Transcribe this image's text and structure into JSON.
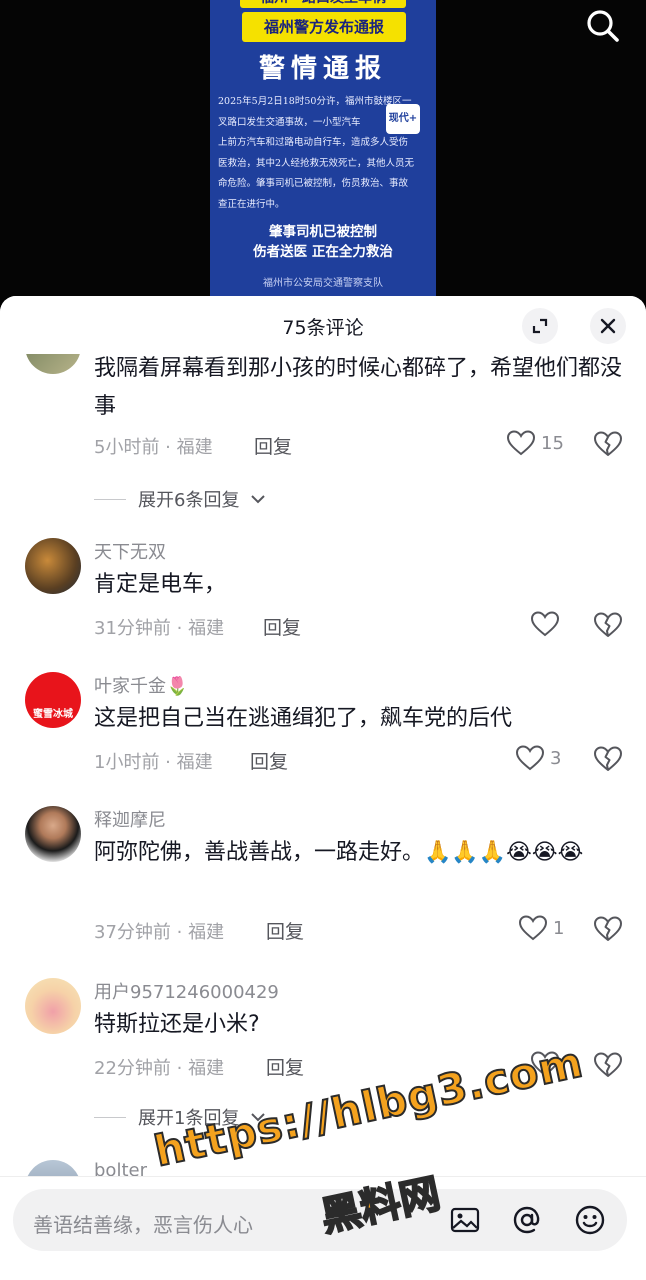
{
  "poster": {
    "headline_top": "福州一路口发生车祸",
    "headline": "福州警方发布通报",
    "title": "警情通报",
    "body_lines": [
      "2025年5月2日18时50分许，福州市鼓楼区一",
      "叉路口发生交通事故，一小型汽车",
      "上前方汽车和过路电动自行车，造成多人受伤",
      "医救治，其中2人经抢救无效死亡，其他人员无",
      "命危险。肇事司机已被控制，伤员救治、事故",
      "查正在进行中。"
    ],
    "stamp": "现代+",
    "summary_1": "肇事司机已被控制",
    "summary_2": "伤者送医 正在全力救治",
    "footer": "福州市公安局交通警察支队"
  },
  "sheet": {
    "title": "75条评论"
  },
  "comments": [
    {
      "text": "我隔着屏幕看到那小孩的时候心都碎了，希望他们都没事",
      "time": "5小时前 · 福建",
      "reply": "回复",
      "likes": "15",
      "expand": "展开6条回复"
    },
    {
      "user": "天下无双",
      "text": "肯定是电车，",
      "time": "31分钟前 · 福建",
      "reply": "回复",
      "likes": ""
    },
    {
      "user": "叶家千金🌷",
      "avatar_text": "蜜雪冰城",
      "text": "这是把自己当在逃通缉犯了，飙车党的后代",
      "time": "1小时前 · 福建",
      "reply": "回复",
      "likes": "3"
    },
    {
      "user": "释迦摩尼",
      "text": "阿弥陀佛，善战善战，一路走好。🙏🙏🙏😭😭😭",
      "time": "37分钟前 · 福建",
      "reply": "回复",
      "likes": "1"
    },
    {
      "user": "用户9571246000429",
      "text": "特斯拉还是小米?",
      "time": "22分钟前 · 福建",
      "reply": "回复",
      "likes": "",
      "expand": "展开1条回复"
    },
    {
      "user": "bolter"
    }
  ],
  "input": {
    "placeholder": "善语结善缘，恶言伤人心"
  },
  "watermark": {
    "line1": "https://hlbg3.com",
    "line2": "黑料网"
  },
  "colors": {
    "poster_blue": "#1f3f9c",
    "highlight_yellow": "#f5e100",
    "watermark_orange": "#f4a21e"
  }
}
